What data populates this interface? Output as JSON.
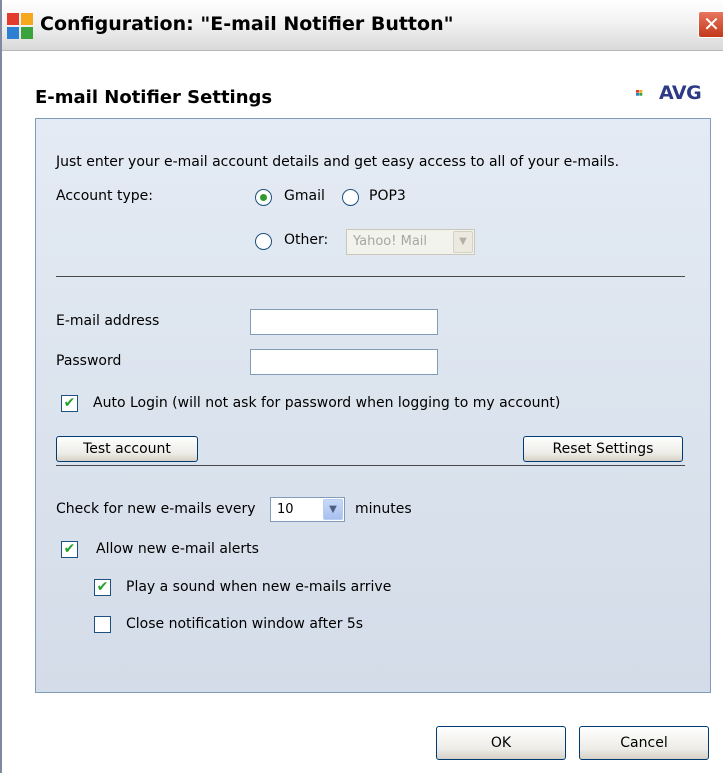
{
  "window": {
    "title": "Configuration: \"E-mail Notifier Button\"",
    "close_label": "✕"
  },
  "header": {
    "heading": "E-mail Notifier Settings",
    "logo_text": "AVG"
  },
  "panel": {
    "intro": "Just enter your e-mail account details and get easy access to all of your e-mails.",
    "account_type_label": "Account type:",
    "radio_gmail": "Gmail",
    "radio_pop3": "POP3",
    "radio_other": "Other:",
    "other_select_value": "Yahoo! Mail",
    "selected_account_type": "Gmail",
    "email_label": "E-mail address",
    "email_value": "",
    "password_label": "Password",
    "password_value": "",
    "auto_login_label": "Auto Login (will not ask for password when logging to my account)",
    "auto_login_checked": true,
    "test_account_button": "Test account",
    "reset_settings_button": "Reset Settings",
    "check_interval_prefix": "Check for new e-mails every",
    "check_interval_value": "10",
    "check_interval_suffix": "minutes",
    "allow_alerts_label": "Allow new e-mail alerts",
    "allow_alerts_checked": true,
    "play_sound_label": "Play a sound when new e-mails arrive",
    "play_sound_checked": true,
    "close_window_label": "Close notification window after 5s",
    "close_window_checked": false,
    "checkmark": "✔"
  },
  "footer": {
    "ok_button": "OK",
    "cancel_button": "Cancel"
  },
  "colors": {
    "panel_bg": "#dbe3ee",
    "radio_selected": "#2f9a2f",
    "checkmark": "#22a12b",
    "logo_text": "#2d3b86"
  }
}
